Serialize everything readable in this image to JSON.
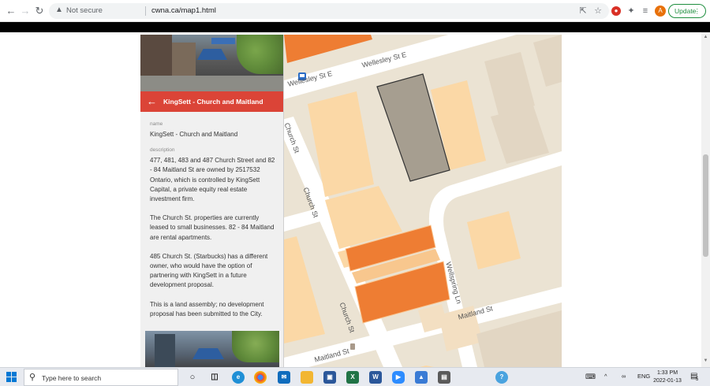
{
  "browser": {
    "security_label": "Not secure",
    "url": "cwna.ca/map1.html",
    "update_label": "Update",
    "avatar_letter": "A",
    "icons": [
      "back-icon",
      "forward-icon",
      "reload-icon",
      "warning-icon",
      "share-icon",
      "star-icon",
      "extension-icon",
      "puzzle-icon",
      "reading-list-icon",
      "menu-icon"
    ]
  },
  "panel": {
    "title": "KingSett - Church and Maitland",
    "name_label": "name",
    "name_value": "KingSett - Church and Maitland",
    "description_label": "description",
    "paragraphs": [
      "477, 481, 483 and 487 Church Street and 82 - 84 Maitland St are owned by 2517532 Ontario, which is controlled by KingSett Capital, a private equity real estate investment firm.",
      "The Church St. properties are currently leased to small businesses. 82 - 84 Maitland are rental apartments.",
      "485 Church St. (Starbucks) has a different owner, who would have the option of partnering with KingSett in a future development proposal.",
      "This is a land assembly; no development proposal has been submitted to the City."
    ]
  },
  "map": {
    "streets": [
      "Wellesley St E",
      "Wellesley St E",
      "Church St",
      "Church St",
      "Church St",
      "Wellspring Ln",
      "Maitland St",
      "Maitland St"
    ],
    "colors": {
      "ground": "#ebe3d3",
      "road": "#ffffff",
      "building": "#fbd8a6",
      "highlight": "#ee7d33",
      "selected": "#a69e90"
    }
  },
  "taskbar": {
    "search_placeholder": "Type here to search",
    "language": "ENG",
    "time": "1:33 PM",
    "date": "2022-01-13",
    "notification_count": "5"
  }
}
